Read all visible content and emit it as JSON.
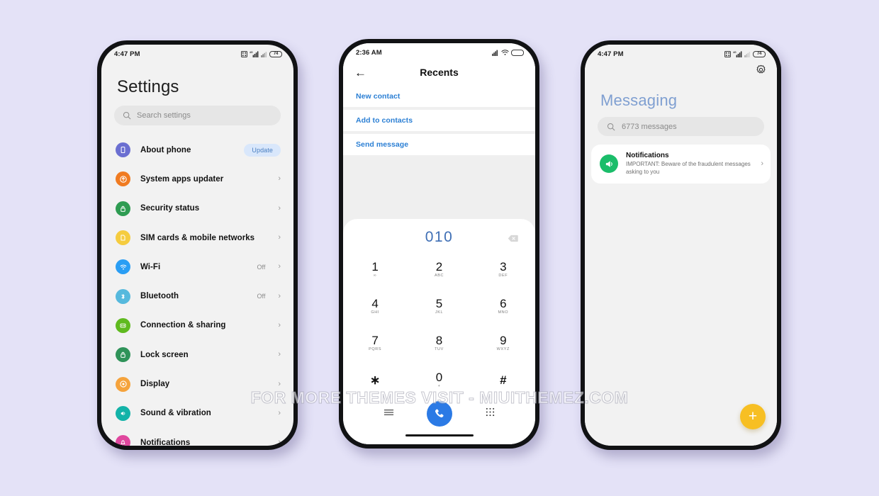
{
  "background_color": "#e4e2f7",
  "watermark": "FOR MORE THEMES VISIT - MIUITHEMEZ.COM",
  "phone_settings": {
    "status": {
      "time": "4:47 PM",
      "battery": "74"
    },
    "title": "Settings",
    "search": {
      "placeholder": "Search settings",
      "icon": "search-icon"
    },
    "items": [
      {
        "label": "About phone",
        "icon": "phone-info-icon",
        "color": "#6b6fd1",
        "badge": "Update",
        "value": "",
        "chevron": false
      },
      {
        "label": "System apps updater",
        "icon": "update-arrow-icon",
        "color": "#f07b21",
        "badge": "",
        "value": "",
        "chevron": true
      },
      {
        "label": "Security status",
        "icon": "lock-shield-icon",
        "color": "#2e9c52",
        "badge": "",
        "value": "",
        "chevron": true
      },
      {
        "label": "SIM cards & mobile networks",
        "icon": "sim-card-icon",
        "color": "#f5cc3f",
        "badge": "",
        "value": "",
        "chevron": true
      },
      {
        "label": "Wi-Fi",
        "icon": "wifi-icon",
        "color": "#2a9ef4",
        "badge": "",
        "value": "Off",
        "chevron": true
      },
      {
        "label": "Bluetooth",
        "icon": "bluetooth-icon",
        "color": "#56b9dd",
        "badge": "",
        "value": "Off",
        "chevron": true
      },
      {
        "label": "Connection & sharing",
        "icon": "connection-icon",
        "color": "#5fba1f",
        "badge": "",
        "value": "",
        "chevron": true
      },
      {
        "label": "Lock screen",
        "icon": "padlock-icon",
        "color": "#2f9359",
        "badge": "",
        "value": "",
        "chevron": true
      },
      {
        "label": "Display",
        "icon": "brightness-icon",
        "color": "#f5a33c",
        "badge": "",
        "value": "",
        "chevron": true
      },
      {
        "label": "Sound & vibration",
        "icon": "speaker-icon",
        "color": "#13b3a8",
        "badge": "",
        "value": "",
        "chevron": true
      },
      {
        "label": "Notifications",
        "icon": "bell-icon",
        "color": "#e0479e",
        "badge": "",
        "value": "",
        "chevron": true
      }
    ]
  },
  "phone_dialer": {
    "status": {
      "time": "2:36 AM"
    },
    "header": {
      "title": "Recents",
      "back_icon": "back-arrow-icon"
    },
    "options": [
      {
        "label": "New contact"
      },
      {
        "label": "Add to contacts"
      },
      {
        "label": "Send message"
      }
    ],
    "dial": {
      "number": "010",
      "backspace_icon": "backspace-icon",
      "keys": [
        {
          "digit": "1",
          "sub": "∞"
        },
        {
          "digit": "2",
          "sub": "ABC"
        },
        {
          "digit": "3",
          "sub": "DEF"
        },
        {
          "digit": "4",
          "sub": "GHI"
        },
        {
          "digit": "5",
          "sub": "JKL"
        },
        {
          "digit": "6",
          "sub": "MNO"
        },
        {
          "digit": "7",
          "sub": "PQRS"
        },
        {
          "digit": "8",
          "sub": "TUV"
        },
        {
          "digit": "9",
          "sub": "WXYZ"
        },
        {
          "digit": "∗",
          "sub": ""
        },
        {
          "digit": "0",
          "sub": "+"
        },
        {
          "digit": "#",
          "sub": ""
        }
      ],
      "bottom": {
        "menu_icon": "menu-lines-icon",
        "call_icon": "phone-call-icon",
        "keypad_icon": "keypad-grid-icon",
        "call_color": "#2b7ae5"
      }
    }
  },
  "phone_messaging": {
    "status": {
      "time": "4:47 PM",
      "battery": "74"
    },
    "gear_icon": "gear-icon",
    "title": "Messaging",
    "title_color": "#7f9fd1",
    "search": {
      "value": "6773 messages",
      "icon": "search-icon"
    },
    "conversation": {
      "avatar_icon": "megaphone-icon",
      "avatar_color": "#1bbd6a",
      "name": "Notifications",
      "preview": "IMPORTANT: Beware of the fraudulent messages asking to you",
      "chevron": "›"
    },
    "fab": {
      "icon": "plus-icon",
      "color": "#f7bf23"
    }
  }
}
